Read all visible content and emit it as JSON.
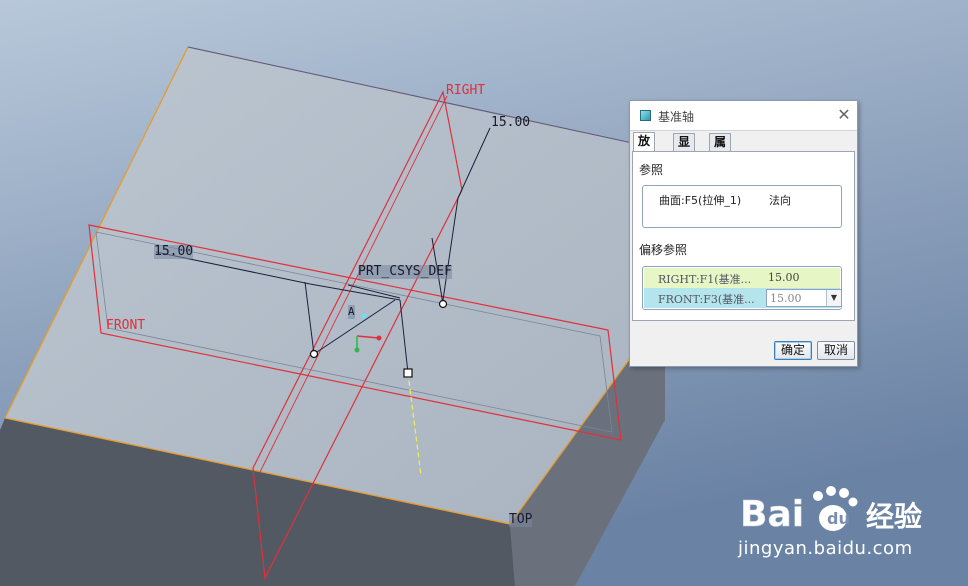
{
  "viewport": {
    "labels": {
      "right_plane": "RIGHT",
      "front_plane": "FRONT",
      "top_plane": "TOP",
      "csys": "PRT_CSYS_DEF",
      "dim_right": "15.00",
      "dim_front": "15.00",
      "axis_tag": "A"
    },
    "colors": {
      "background_top": "#aebfd3",
      "background_bottom": "#6f86a8",
      "top_face": "#b6c1cd",
      "side_face": "#4f5560",
      "front_face": "#6a727f",
      "plane_red": "#e0303a",
      "edge_orange": "#e89b2a"
    }
  },
  "dialog": {
    "title": "基准轴",
    "tabs": [
      {
        "label": "放置",
        "active": true
      },
      {
        "label": "显示",
        "active": false
      },
      {
        "label": "属性",
        "active": false
      }
    ],
    "references_label": "参照",
    "reference": {
      "surface": "曲面:F5(拉伸_1)",
      "constraint": "法向"
    },
    "offset_label": "偏移参照",
    "offsets": [
      {
        "name": "RIGHT:F1(基准...",
        "value": "15.00"
      },
      {
        "name": "FRONT:F3(基准...",
        "value": "15.00"
      }
    ],
    "ok_label": "确定",
    "cancel_label": "取消"
  },
  "watermark": {
    "logo": "Bai du 经验",
    "url": "jingyan.baidu.com"
  }
}
